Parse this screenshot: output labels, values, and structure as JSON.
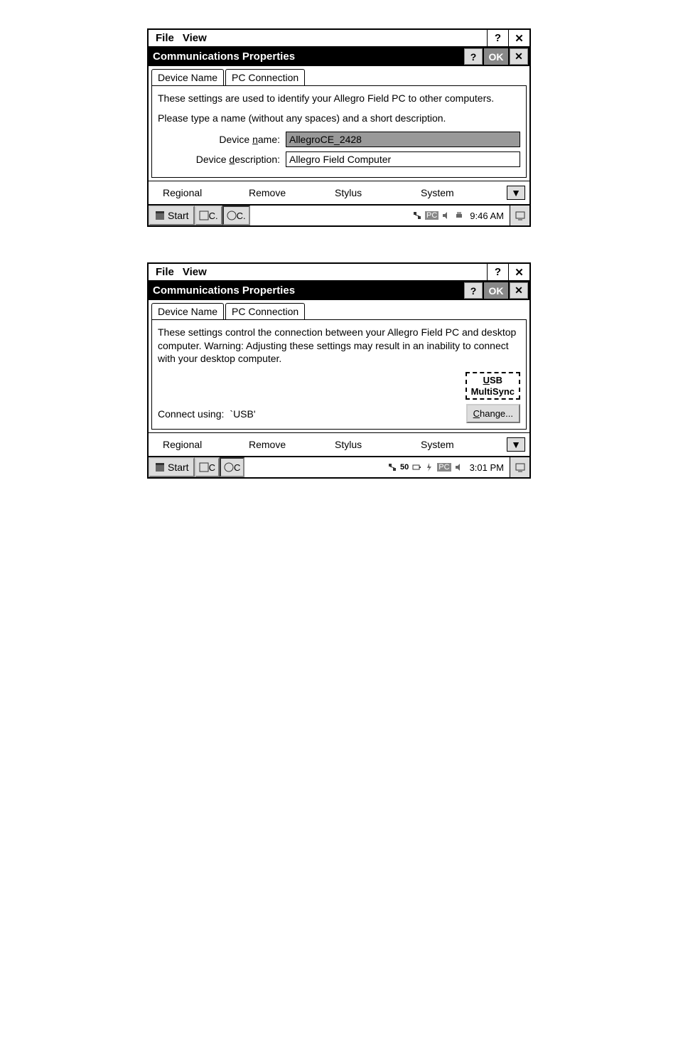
{
  "win1": {
    "menu": {
      "file": "File",
      "view": "View",
      "help": "?",
      "close": "✕"
    },
    "title": "Communications Properties",
    "titlebar": {
      "help": "?",
      "ok": "OK",
      "close": "✕"
    },
    "tabs": {
      "device_name": "Device Name",
      "pc_connection": "PC Connection"
    },
    "panel": {
      "intro": "These settings are used to identify your Allegro Field PC to other computers.",
      "hint": "Please type a name (without any spaces) and a short description.",
      "name_label": "Device name:",
      "name_value": "AllegroCE_2428",
      "desc_label": "Device description:",
      "desc_value": "Allegro Field Computer"
    },
    "cpanel": {
      "regional": "Regional",
      "remove": "Remove",
      "stylus": "Stylus",
      "system": "System",
      "arrow": "▼"
    },
    "taskbar": {
      "start": "Start",
      "btn1": "C.",
      "btn2": "C.",
      "pc": "PC",
      "time": "9:46 AM"
    }
  },
  "win2": {
    "menu": {
      "file": "File",
      "view": "View",
      "help": "?",
      "close": "✕"
    },
    "title": "Communications Properties",
    "titlebar": {
      "help": "?",
      "ok": "OK",
      "close": "✕"
    },
    "tabs": {
      "device_name": "Device Name",
      "pc_connection": "PC Connection"
    },
    "panel": {
      "intro": "These settings control the connection between your Allegro Field PC and desktop computer.  Warning: Adjusting these settings may result in an inability to connect with your desktop computer.",
      "usb_line1": "USB",
      "usb_line2": "MultiSync",
      "connect_label": "Connect using:",
      "connect_value": "`USB'",
      "change": "Change..."
    },
    "cpanel": {
      "regional": "Regional",
      "remove": "Remove",
      "stylus": "Stylus",
      "system": "System",
      "arrow": "▼"
    },
    "taskbar": {
      "start": "Start",
      "btn1": "C",
      "btn2": "C",
      "aux": "50",
      "pc": "PC",
      "time": "3:01 PM"
    }
  }
}
